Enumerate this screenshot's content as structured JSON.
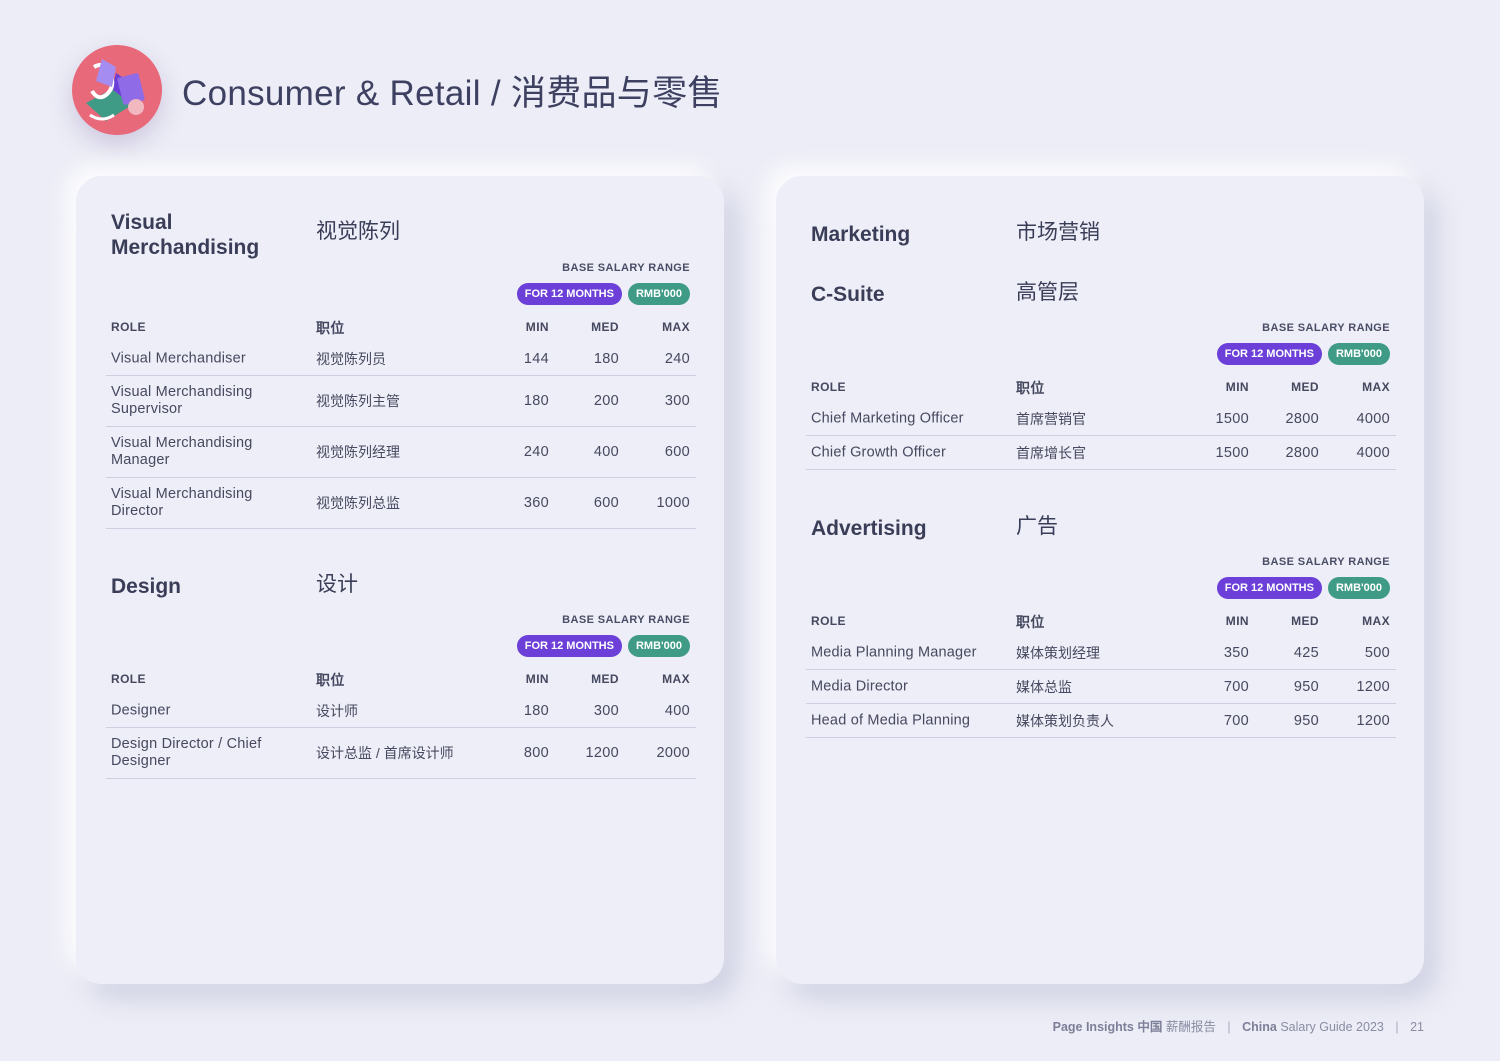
{
  "page": {
    "title": "Consumer & Retail / 消费品与零售",
    "page_number": "21"
  },
  "footer": {
    "brand_bold": "Page Insights",
    "brand_cn_bold": "中国",
    "brand_cn": "薪酬报告",
    "guide_bold": "China",
    "guide": "Salary Guide 2023"
  },
  "common": {
    "salary_label": "BASE SALARY RANGE",
    "pill_months": "FOR 12 MONTHS",
    "pill_currency": "RMB'000",
    "col_role": "ROLE",
    "col_role_cn": "职位",
    "col_min": "MIN",
    "col_med": "MED",
    "col_max": "MAX"
  },
  "sections": {
    "visual": {
      "title_en": "Visual Merchandising",
      "title_cn": "视觉陈列",
      "rows": [
        {
          "role": "Visual Merchandiser",
          "role_cn": "视觉陈列员",
          "min": "144",
          "med": "180",
          "max": "240"
        },
        {
          "role": "Visual Merchandising Supervisor",
          "role_cn": "视觉陈列主管",
          "min": "180",
          "med": "200",
          "max": "300"
        },
        {
          "role": "Visual Merchandising Manager",
          "role_cn": "视觉陈列经理",
          "min": "240",
          "med": "400",
          "max": "600"
        },
        {
          "role": "Visual Merchandising Director",
          "role_cn": "视觉陈列总监",
          "min": "360",
          "med": "600",
          "max": "1000"
        }
      ]
    },
    "design": {
      "title_en": "Design",
      "title_cn": "设计",
      "rows": [
        {
          "role": "Designer",
          "role_cn": "设计师",
          "min": "180",
          "med": "300",
          "max": "400"
        },
        {
          "role": "Design Director / Chief Designer",
          "role_cn": "设计总监 / 首席设计师",
          "min": "800",
          "med": "1200",
          "max": "2000"
        }
      ]
    },
    "marketing": {
      "title_en": "Marketing",
      "title_cn": "市场营销"
    },
    "csuite": {
      "title_en": "C-Suite",
      "title_cn": "高管层",
      "rows": [
        {
          "role": "Chief Marketing Officer",
          "role_cn": "首席营销官",
          "min": "1500",
          "med": "2800",
          "max": "4000"
        },
        {
          "role": "Chief Growth Officer",
          "role_cn": "首席增长官",
          "min": "1500",
          "med": "2800",
          "max": "4000"
        }
      ]
    },
    "advertising": {
      "title_en": "Advertising",
      "title_cn": "广告",
      "rows": [
        {
          "role": "Media Planning Manager",
          "role_cn": "媒体策划经理",
          "min": "350",
          "med": "425",
          "max": "500"
        },
        {
          "role": "Media Director",
          "role_cn": "媒体总监",
          "min": "700",
          "med": "950",
          "max": "1200"
        },
        {
          "role": "Head of Media Planning",
          "role_cn": "媒体策划负责人",
          "min": "700",
          "med": "950",
          "max": "1200"
        }
      ]
    }
  }
}
